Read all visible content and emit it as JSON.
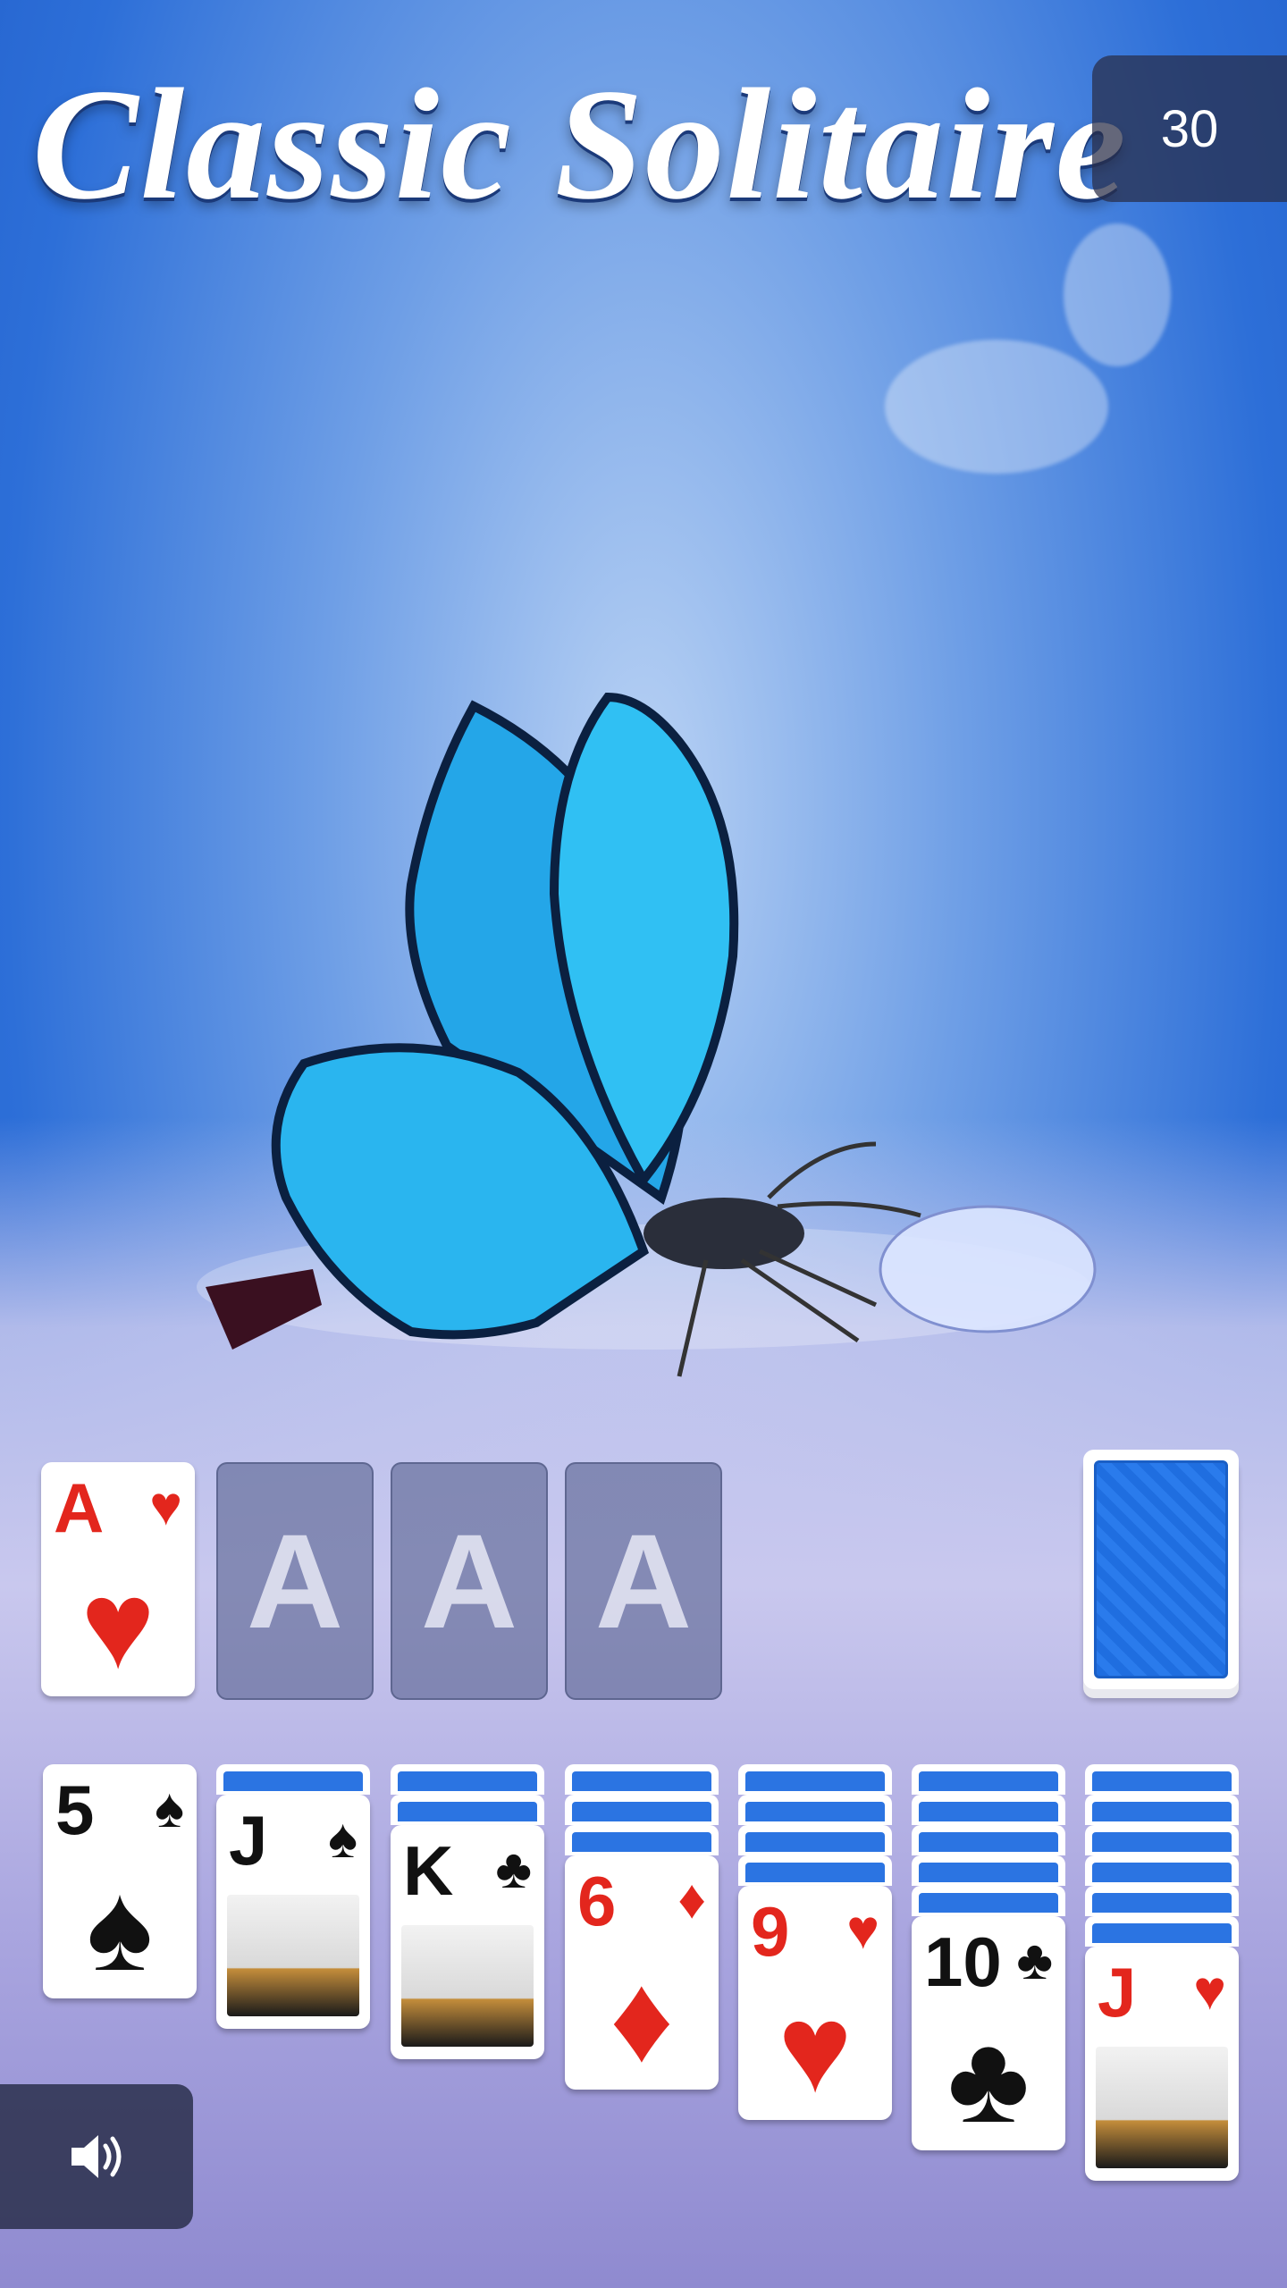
{
  "title": "Classic Solitaire",
  "timer": "30",
  "foundations": [
    {
      "rank": "A",
      "suit": "♥",
      "color": "red",
      "filled": true
    },
    {
      "placeholder": "A",
      "filled": false
    },
    {
      "placeholder": "A",
      "filled": false
    },
    {
      "placeholder": "A",
      "filled": false
    }
  ],
  "stock": {
    "icon": "card-back-icon"
  },
  "tableau": [
    {
      "hidden": 0,
      "rank": "5",
      "suit": "♠",
      "color": "black"
    },
    {
      "hidden": 1,
      "rank": "J",
      "suit": "♠",
      "color": "black",
      "face": true
    },
    {
      "hidden": 2,
      "rank": "K",
      "suit": "♣",
      "color": "black",
      "face": true
    },
    {
      "hidden": 3,
      "rank": "6",
      "suit": "♦",
      "color": "red"
    },
    {
      "hidden": 4,
      "rank": "9",
      "suit": "♥",
      "color": "red"
    },
    {
      "hidden": 5,
      "rank": "10",
      "suit": "♣",
      "color": "black"
    },
    {
      "hidden": 6,
      "rank": "J",
      "suit": "♥",
      "color": "red",
      "face": true
    }
  ],
  "sound_button": {
    "icon": "speaker-icon"
  }
}
